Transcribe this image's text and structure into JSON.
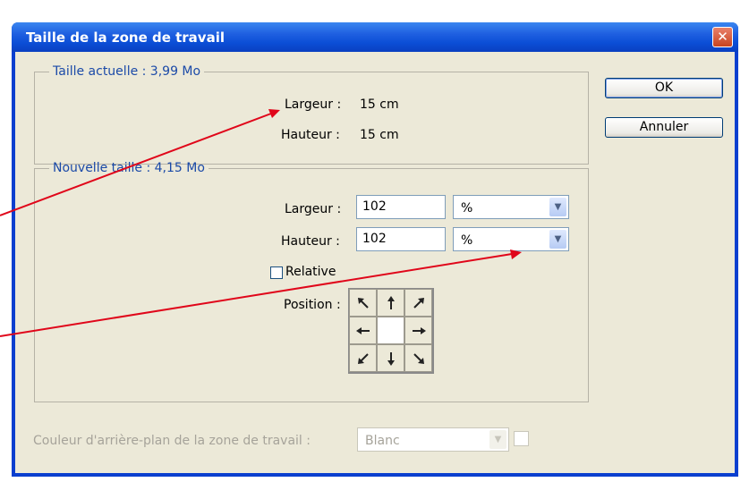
{
  "window": {
    "title": "Taille de la zone de travail"
  },
  "current": {
    "legend": "Taille actuelle : 3,99 Mo",
    "width_label": "Largeur :",
    "width_value": "15 cm",
    "height_label": "Hauteur :",
    "height_value": "15 cm"
  },
  "new_size": {
    "legend": "Nouvelle taille : 4,15 Mo",
    "width_label": "Largeur :",
    "width_value": "102",
    "width_unit": "%",
    "height_label": "Hauteur :",
    "height_value": "102",
    "height_unit": "%",
    "relative_label": "Relative",
    "relative_checked": false,
    "position_label": "Position :",
    "anchor_icons": [
      "arrow-up-left-icon",
      "arrow-up-icon",
      "arrow-up-right-icon",
      "arrow-left-icon",
      "anchor-center",
      "arrow-right-icon",
      "arrow-down-left-icon",
      "arrow-down-icon",
      "arrow-down-right-icon"
    ]
  },
  "background": {
    "label": "Couleur d'arrière-plan de la zone de travail :",
    "value": "Blanc"
  },
  "buttons": {
    "ok": "OK",
    "cancel": "Annuler"
  },
  "colors": {
    "annotation_arrow": "#e0061a",
    "title_bar": "#0b4ed6",
    "legend_text": "#1b4aa8"
  }
}
